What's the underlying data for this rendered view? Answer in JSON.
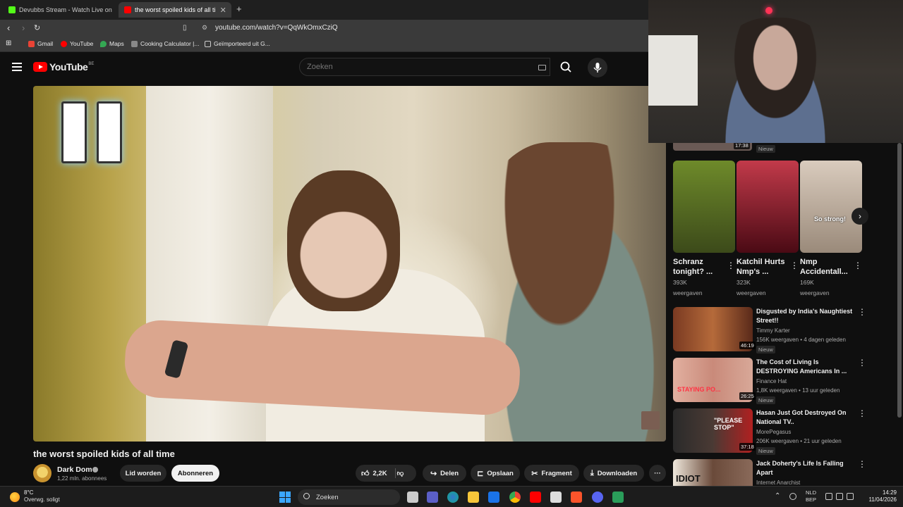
{
  "browser": {
    "tabs": [
      {
        "title": "Devubbs Stream - Watch Live on",
        "favicon_color": "#53fc18"
      },
      {
        "title": "the worst spoiled kids of all ti",
        "favicon_color": "#ff0000"
      }
    ],
    "new_tab_label": "+",
    "url": "youtube.com/watch?v=QqWkOmxCziQ",
    "bookmarks": [
      {
        "label": "Gmail",
        "color": "#ea4335"
      },
      {
        "label": "YouTube",
        "color": "#ff0000"
      },
      {
        "label": "Maps",
        "color": "#34a853"
      },
      {
        "label": "Cooking Calculator |...",
        "color": "#888888"
      },
      {
        "label": "Geïmporteerd uit G...",
        "color": "#cccccc"
      }
    ]
  },
  "youtube": {
    "logo_text": "YouTube",
    "logo_country": "BE",
    "search_placeholder": "Zoeken"
  },
  "video": {
    "title": "the worst spoiled kids of all time",
    "channel": "Dark Dom",
    "subscribers": "1,22 mln. abonnees",
    "join_label": "Lid worden",
    "subscribe_label": "Abonneren",
    "likes": "2,2K",
    "share_label": "Delen",
    "save_label": "Opslaan",
    "clip_label": "Fragment",
    "download_label": "Downloaden",
    "more_label": "···"
  },
  "sidebar": {
    "partial": {
      "duration": "17:38",
      "badge": "Nieuw"
    },
    "shorts": [
      {
        "title": "Schranz tonight? ...",
        "views": "393K",
        "views_label": "weergaven",
        "thumb": "#5a7a2a"
      },
      {
        "title": "Katchil Hurts Nmp's ...",
        "views": "323K",
        "views_label": "weergaven",
        "thumb": "#8a1a2a"
      },
      {
        "title": "Nmp Accidentall...",
        "views": "169K",
        "views_label": "weergaven",
        "thumb": "#c9b8a8",
        "caption": "So strong!"
      }
    ],
    "videos": [
      {
        "title": "Disgusted by India's Naughtiest Street!!",
        "channel": "Timmy Karter",
        "meta": "156K weergaven • 4 dagen geleden",
        "badge": "Nieuw",
        "duration": "46:19",
        "thumb": "#8a4a2a"
      },
      {
        "title": "The Cost of Living Is DESTROYING Americans In ...",
        "channel": "Finance Hat",
        "meta": "1,8K weergaven • 13 uur geleden",
        "badge": "Nieuw",
        "duration": "26:25",
        "thumb": "#b84a5a",
        "caption": "STAYING PO..."
      },
      {
        "title": "Hasan Just Got Destroyed On National TV..",
        "channel": "MorePegasus",
        "meta": "206K weergaven • 21 uur geleden",
        "badge": "Nieuw",
        "duration": "37:18",
        "thumb": "#3a3a3a",
        "caption": "\"PLEASE STOP\""
      },
      {
        "title": "Jack Doherty's Life Is Falling Apart",
        "channel": "Internet Anarchist",
        "meta": "",
        "badge": "",
        "duration": "",
        "thumb": "#6a5a4a",
        "caption": "IDIOT"
      }
    ]
  },
  "taskbar": {
    "weather_temp": "8°C",
    "weather_desc": "Overwg. soligt",
    "search_label": "Zoeken",
    "lang_line1": "NLD",
    "lang_line2": "BEP",
    "time": "14:29",
    "date": "11/04/2026"
  }
}
